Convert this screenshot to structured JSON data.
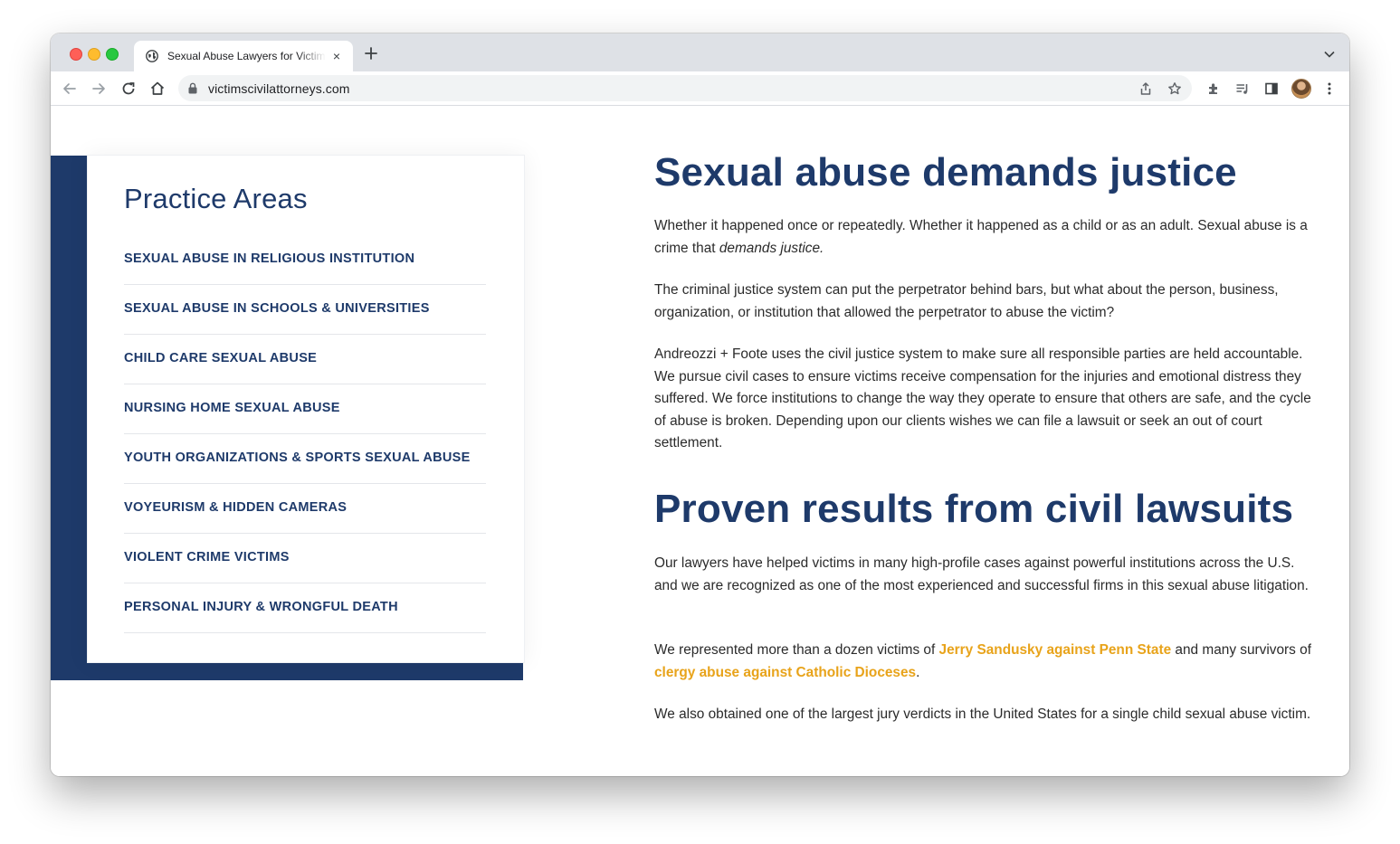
{
  "browser": {
    "tab_title": "Sexual Abuse Lawyers for Victims",
    "url": "victimscivilattorneys.com"
  },
  "sidebar": {
    "title": "Practice Areas",
    "items": [
      {
        "label": "SEXUAL ABUSE IN RELIGIOUS INSTITUTION"
      },
      {
        "label": "SEXUAL ABUSE IN SCHOOLS & UNIVERSITIES"
      },
      {
        "label": "CHILD CARE SEXUAL ABUSE"
      },
      {
        "label": "NURSING HOME SEXUAL ABUSE"
      },
      {
        "label": "YOUTH ORGANIZATIONS & SPORTS SEXUAL ABUSE"
      },
      {
        "label": "VOYEURISM & HIDDEN CAMERAS"
      },
      {
        "label": "VIOLENT CRIME VICTIMS"
      },
      {
        "label": "PERSONAL INJURY & WRONGFUL DEATH"
      }
    ]
  },
  "main": {
    "heading1": "Sexual abuse demands justice",
    "p1_text": "Whether it happened once or repeatedly. Whether it happened as a child or as an adult. Sexual abuse is a crime that ",
    "p1_em": "demands justice.",
    "p2": "The criminal justice system can put the perpetrator behind bars, but what about the person, business, organization, or institution that allowed the perpetrator to abuse the victim?",
    "p3": "Andreozzi + Foote uses the civil justice system to make sure all responsible parties are held accountable.  We pursue civil cases to ensure victims receive compensation for the injuries and emotional distress they suffered.  We force institutions to change the way they operate to ensure that others are safe, and the cycle of abuse is broken. Depending upon our clients wishes we can file a lawsuit or seek an out of court settlement.",
    "heading2": "Proven results from civil lawsuits",
    "p4": "Our lawyers have helped victims in many high-profile cases against powerful institutions across the U.S. and we are recognized as one of the most experienced and successful firms in this sexual abuse litigation.",
    "p5_a": "We represented more than a dozen victims of ",
    "p5_link1": "Jerry Sandusky against Penn State",
    "p5_b": " and many survivors of ",
    "p5_link2": "clergy abuse against Catholic Dioceses",
    "p5_c": ".",
    "p6": "We also obtained one of the largest jury verdicts in the United States for a single child sexual abuse victim."
  },
  "colors": {
    "navy": "#1e3a6a",
    "link_gold": "#e8a31a"
  }
}
